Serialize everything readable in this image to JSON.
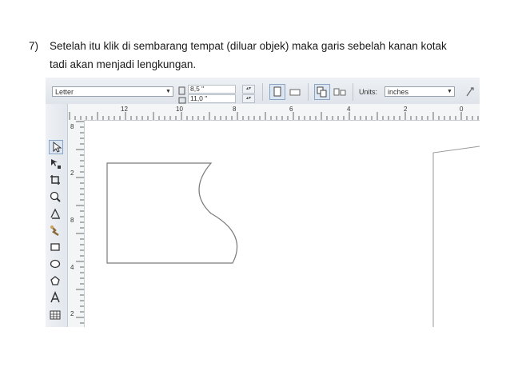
{
  "instruction": {
    "number": "7)",
    "text_line1": "Setelah itu klik di sembarang tempat (diluar objek) maka garis sebelah kanan kotak",
    "text_line2": "tadi akan menjadi lengkungan."
  },
  "propbar": {
    "paper_size": "Letter",
    "width_value": "8,5 \"",
    "height_value": "11,0 \"",
    "units_label": "Units:",
    "units_value": "inches"
  },
  "hruler_labels": [
    "12",
    "10",
    "8",
    "6",
    "4",
    "2",
    "0"
  ],
  "vruler_labels": [
    "8",
    "2",
    "8",
    "4",
    "2",
    "4"
  ],
  "toolbox": {
    "tools": [
      "pick-tool-icon",
      "shape-tool-icon",
      "crop-tool-icon",
      "zoom-tool-icon",
      "freehand-tool-icon",
      "smart-fill-icon",
      "rectangle-tool-icon",
      "ellipse-tool-icon",
      "polygon-tool-icon",
      "text-tool-icon",
      "table-tool-icon"
    ]
  },
  "colors": {
    "toolbar_bg": "#e6eaef",
    "active_tool": "#dce6f3",
    "shape_stroke": "#7a7a7a"
  }
}
